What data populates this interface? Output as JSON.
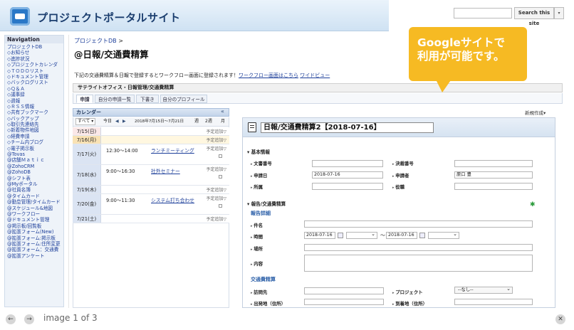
{
  "header": {
    "site_title": "プロジェクトポータルサイト",
    "search_button": "Search this site",
    "search_dropdown": "▾"
  },
  "sidebar": {
    "title": "Navigation",
    "items": [
      "プロジェクトDB",
      "◇お知らせ",
      "◇進捗状況",
      "◇プロジェクトカレンダ",
      "◇ＴＯＤＯリスト",
      "◇ドキュメント管理",
      "◇バックログリスト",
      "◇Ｑ＆Ａ",
      "◇議事録",
      "◇週報",
      "◇ＲＳＳ情報",
      "◇共有ブックマーク",
      "◇バックアップ",
      "◇取引先連絡先",
      "◇新着物件地図",
      "◇経費申請",
      "◇チーム内ブログ",
      "◇電子掲示板",
      "@Tovas",
      "@店舗Ｍａｔｉｃ",
      "@ZohoCRM",
      "@ZohoDB",
      "@シフト表",
      "@Myポータル",
      "@社員名簿",
      "@タイムカード",
      "@勤怠管理/タイムカード",
      "@スケジュール&地図",
      "@ワークフロー",
      "@ドキュメント管理",
      "@掲示板/回覧板",
      "@拡張フォーム(New)",
      "@拡張フォーム:掲示板",
      "@拡張フォーム:住所変更",
      "@拡張フォーム：交通費",
      "@拡張アンケート"
    ]
  },
  "main": {
    "breadcrumb": "プロジェクトDB",
    "breadcrumb_sep": " >",
    "page_title": "@日報/交通費精算",
    "intro_text": "下記の交通費精算＆日報で登録するとワークフロー画面に登録されます！",
    "intro_link1": "ワークフロー画面はこちら",
    "intro_link2": "ワイドビュー",
    "panel_title": "サテライトオフィス・日報管理/交通費精算",
    "tabs": [
      "申請",
      "自分の申請一覧",
      "下書き",
      "自分のプロフィール"
    ],
    "new_button": "新規作成▾"
  },
  "calendar": {
    "title": "カレンダー",
    "collapse": "«",
    "toolbar": {
      "filter": "すべて ▾",
      "today": "今日",
      "prev": "◀",
      "next": "▶",
      "range": "2018年7月15日〜7月21日",
      "week": "週",
      "two_week": "2週",
      "month": "月"
    },
    "add_label": "予定追加▽",
    "rows": [
      {
        "date": "7/15(日)",
        "time": "",
        "event": ""
      },
      {
        "date": "7/16(月)",
        "time": "",
        "event": ""
      },
      {
        "date": "7/17(火)",
        "time": "12:30〜14:00",
        "event": "ランチミーティング"
      },
      {
        "date": "7/18(水)",
        "time": "9:00〜16:30",
        "event": "社外セミナー"
      },
      {
        "date": "7/19(木)",
        "time": "",
        "event": ""
      },
      {
        "date": "7/20(金)",
        "time": "9:00〜11:30",
        "event": "システム打ち合わせ"
      },
      {
        "date": "7/21(土)",
        "time": "",
        "event": ""
      }
    ]
  },
  "form": {
    "title": "日報/交通費精算2【2018-07-16】",
    "basic_section": "基本情報",
    "doc_no": "文書番号",
    "approval_no": "決裁番号",
    "apply_date": "申請日",
    "apply_date_value": "2018-07-16",
    "applicant": "申請者",
    "applicant_value": "原口 豊",
    "dept": "所属",
    "position": "役職",
    "report_section": "報告/交通費精算",
    "report_detail": "報告詳細",
    "subject": "件名",
    "time": "時間",
    "time_from": "2018-07-16",
    "time_sep": "〜",
    "time_to": "2018-07-16",
    "place": "場所",
    "content": "内容",
    "transport": "交通費精算",
    "visit": "訪問先",
    "project": "プロジェクト",
    "project_value": "--なし--",
    "depart": "出発地（住所）",
    "arrive": "到着地（住所）",
    "plus": "✱"
  },
  "callout": {
    "line1": "Googleサイトで",
    "line2": "利用が可能です。"
  },
  "footer": {
    "prev": "←",
    "next": "→",
    "counter": "image 1 of 3",
    "close": "✕"
  }
}
